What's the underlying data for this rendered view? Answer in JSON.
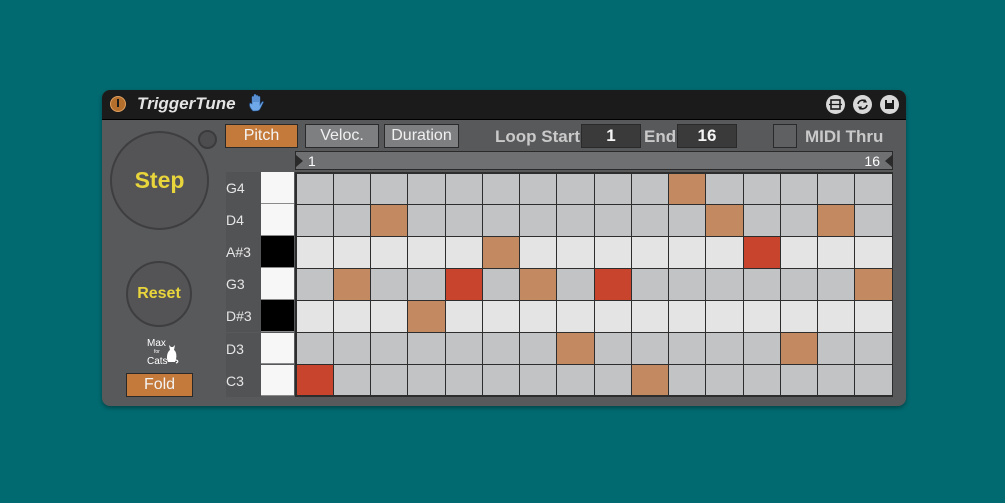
{
  "device": {
    "title": "TriggerTune",
    "icons": {
      "power": "power-icon",
      "hand": "hand-icon",
      "hotswap": "hotswap-icon",
      "refresh": "refresh-icon",
      "save": "save-icon"
    }
  },
  "left_panel": {
    "step_label": "Step",
    "reset_label": "Reset",
    "fold_label": "Fold",
    "logo": {
      "line1": "Max",
      "line2": "for",
      "line3": "Cats"
    }
  },
  "tabs": [
    {
      "label": "Pitch",
      "active": true
    },
    {
      "label": "Veloc.",
      "active": false
    },
    {
      "label": "Duration",
      "active": false
    }
  ],
  "loop": {
    "start_label": "Loop Start",
    "start_value": "1",
    "end_label": "End",
    "end_value": "16"
  },
  "midi_thru": {
    "label": "MIDI Thru",
    "on": false
  },
  "ruler": {
    "start": "1",
    "end": "16"
  },
  "rows": [
    {
      "note": "G4",
      "key": "white",
      "shade": "dark"
    },
    {
      "note": "D4",
      "key": "white",
      "shade": "dark"
    },
    {
      "note": "A#3",
      "key": "black",
      "shade": "light"
    },
    {
      "note": "G3",
      "key": "white",
      "shade": "dark"
    },
    {
      "note": "D#3",
      "key": "black",
      "shade": "light"
    },
    {
      "note": "D3",
      "key": "white",
      "shade": "dark"
    },
    {
      "note": "C3",
      "key": "white",
      "shade": "dark"
    }
  ],
  "steps": [
    {
      "row": 6,
      "type": "red"
    },
    {
      "row": 3,
      "type": "orange"
    },
    {
      "row": 1,
      "type": "orange"
    },
    {
      "row": 4,
      "type": "orange"
    },
    {
      "row": 3,
      "type": "red"
    },
    {
      "row": 2,
      "type": "orange"
    },
    {
      "row": 3,
      "type": "orange"
    },
    {
      "row": 5,
      "type": "orange"
    },
    {
      "row": 3,
      "type": "red"
    },
    {
      "row": 6,
      "type": "orange"
    },
    {
      "row": 0,
      "type": "orange"
    },
    {
      "row": 1,
      "type": "orange"
    },
    {
      "row": 2,
      "type": "red"
    },
    {
      "row": 5,
      "type": "orange"
    },
    {
      "row": 1,
      "type": "orange"
    },
    {
      "row": 3,
      "type": "orange"
    }
  ],
  "colors": {
    "background": "#006a70",
    "accent": "#c47a3b",
    "knob_text": "#e8d53c",
    "cell_dark": "#c2c3c5",
    "cell_light": "#e4e4e4",
    "step_orange": "#c38a62",
    "step_red": "#c8442c"
  }
}
